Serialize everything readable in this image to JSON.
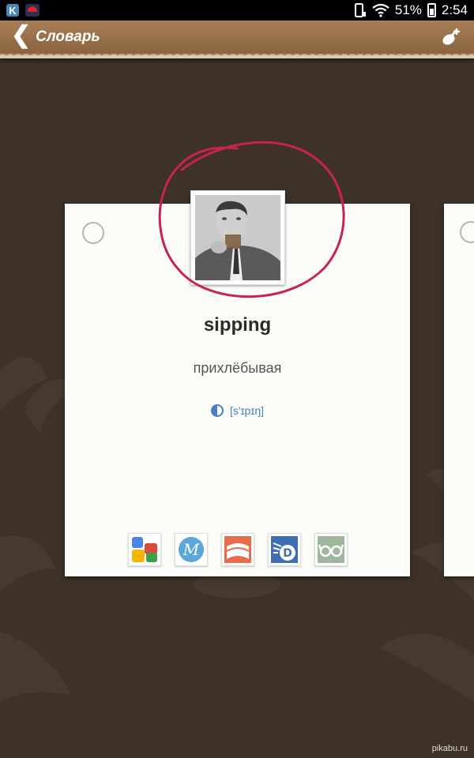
{
  "status_bar": {
    "battery": "51%",
    "time": "2:54",
    "icons": [
      "vk-app-icon",
      "app-icon",
      "phone-rotate-icon",
      "wifi-icon",
      "battery-icon"
    ]
  },
  "header": {
    "back_label": "Словарь",
    "action_icon": "add-meatball-icon"
  },
  "card": {
    "word": "sipping",
    "translation": "прихлёбывая",
    "transcription": "[s'ɪpɪŋ]",
    "dictionaries": [
      "google-dictionary-icon",
      "merriam-webster-icon",
      "book-dictionary-icon",
      "dictionary-com-icon",
      "glasses-dictionary-icon"
    ]
  },
  "watermark": "pikabu.ru"
}
